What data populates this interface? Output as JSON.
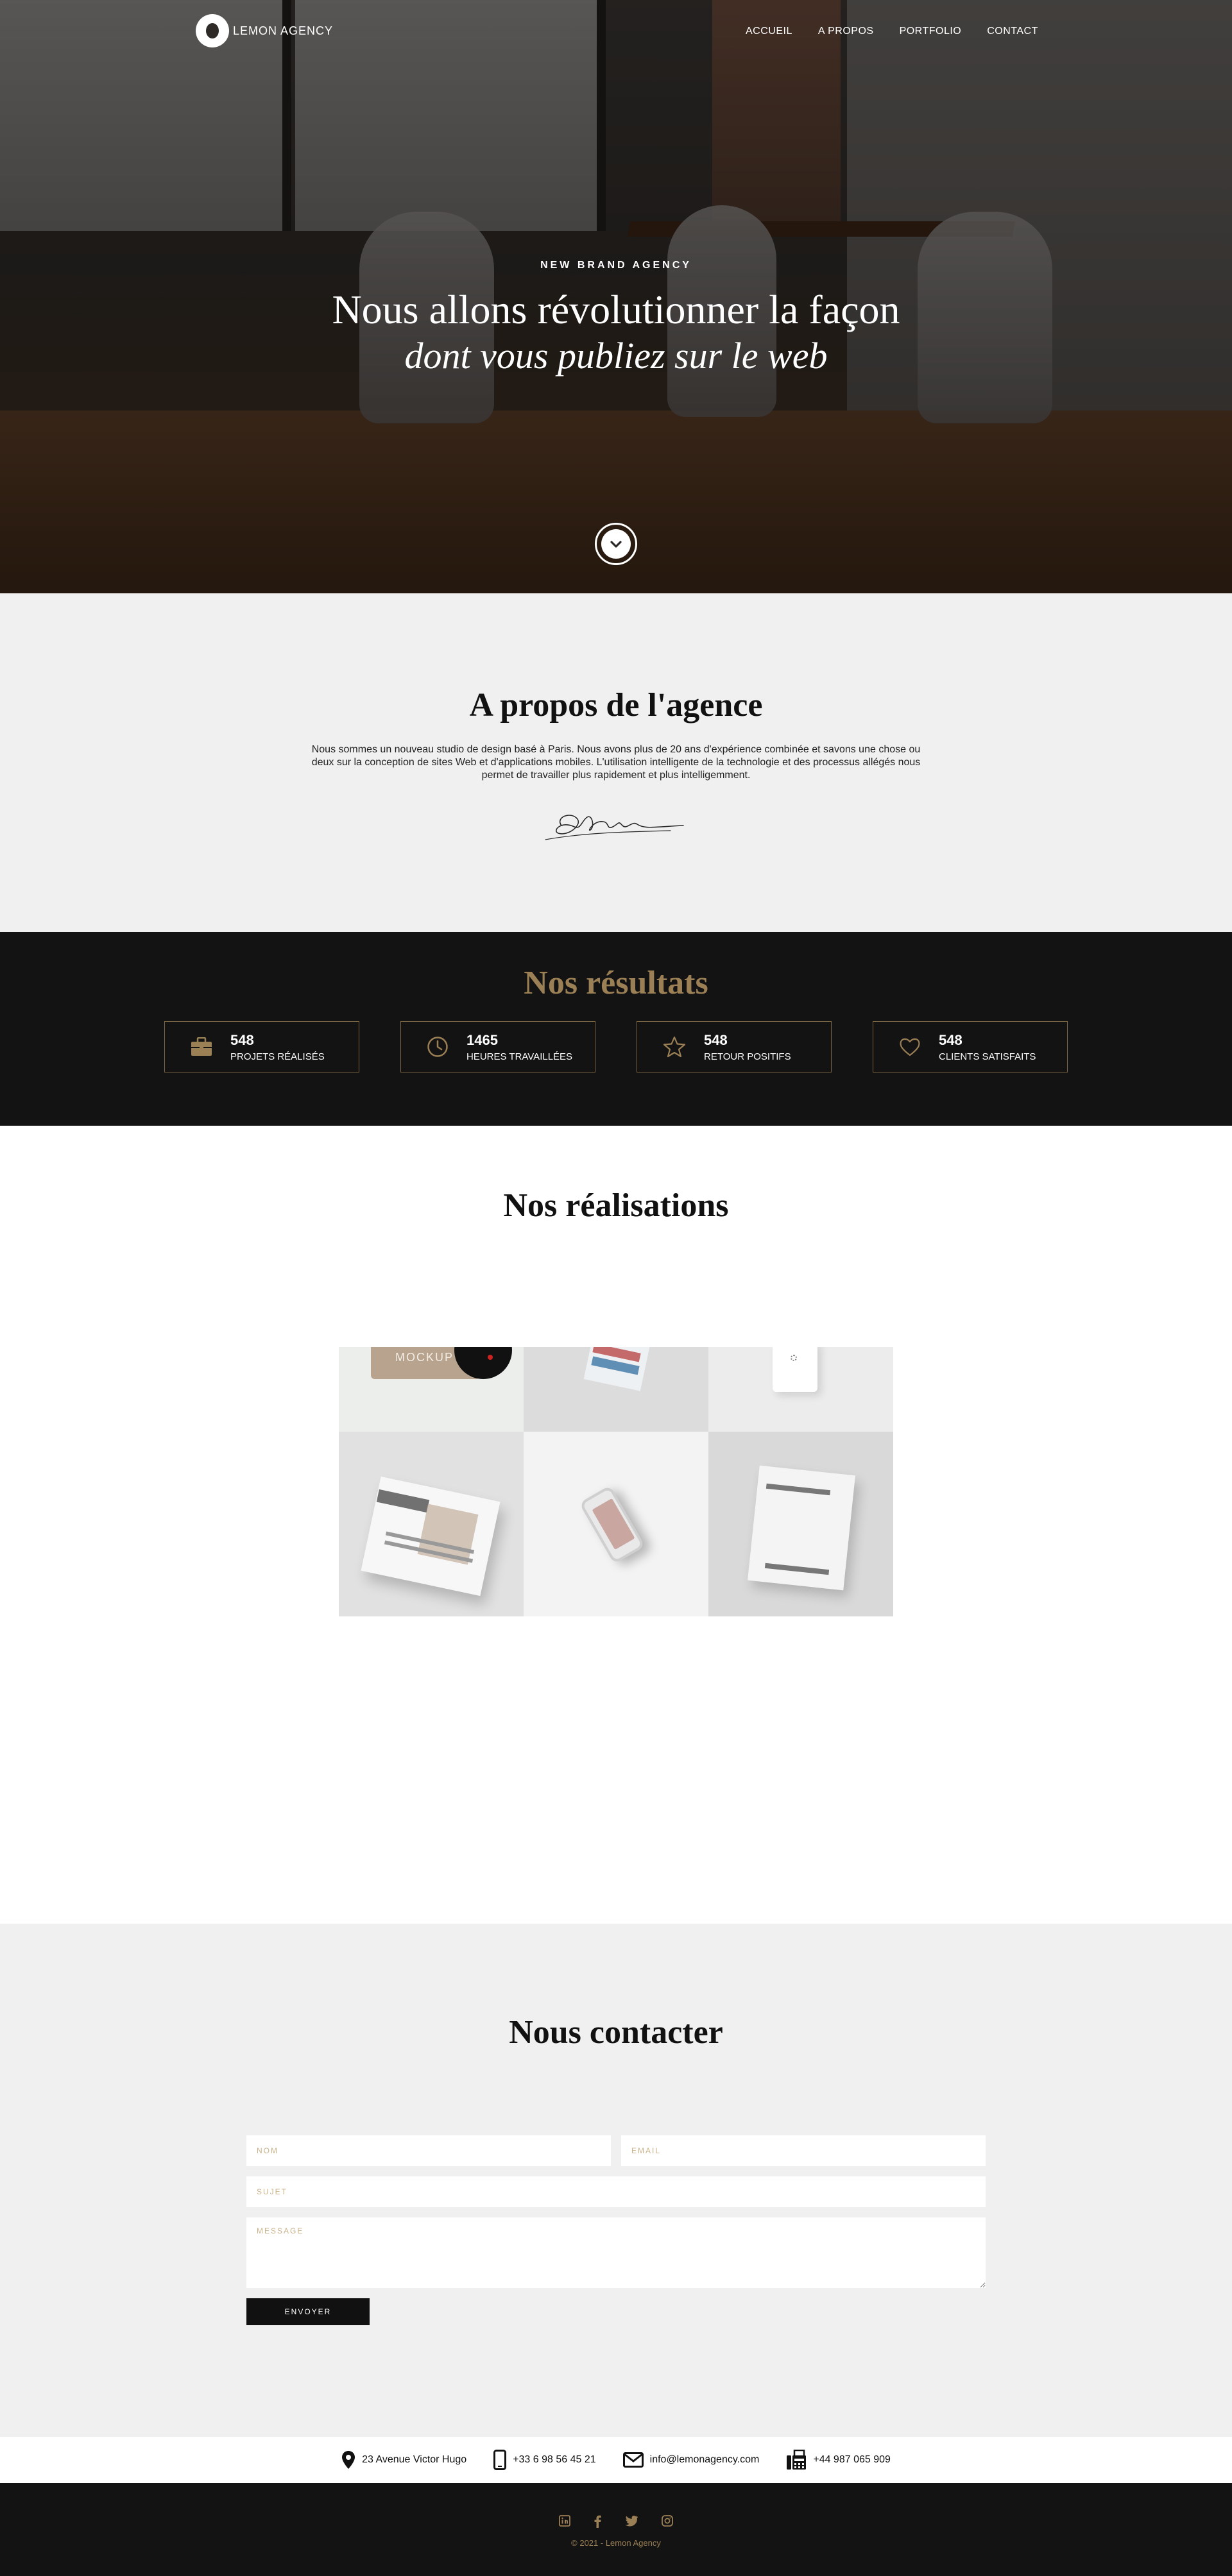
{
  "brand": {
    "name": "LEMON AGENCY"
  },
  "nav": {
    "items": [
      "ACCUEIL",
      "A PROPOS",
      "PORTFOLIO",
      "CONTACT"
    ]
  },
  "hero": {
    "kicker": "NEW BRAND AGENCY",
    "title": "Nous allons révolutionner la façon",
    "subtitle": "dont vous publiez sur le web"
  },
  "about": {
    "title": "A propos de l'agence",
    "text": "Nous sommes un nouveau studio de design basé à Paris. Nous avons plus de 20 ans d'expérience combinée et savons une chose ou deux sur la conception de sites Web et d'applications mobiles. L'utilisation intelligente de la technologie et des processus allégés nous permet de travailler plus rapidement et plus intelligemment."
  },
  "results": {
    "title": "Nos résultats",
    "stats": [
      {
        "icon": "briefcase-icon",
        "value": "548",
        "label": "PROJETS RÉALISÉS"
      },
      {
        "icon": "clock-icon",
        "value": "1465",
        "label": "HEURES TRAVAILLÉES"
      },
      {
        "icon": "star-icon",
        "value": "548",
        "label": "RETOUR POSITIFS"
      },
      {
        "icon": "heart-icon",
        "value": "548",
        "label": "CLIENTS SATISFAITS"
      }
    ]
  },
  "portfolio": {
    "title": "Nos réalisations",
    "tiles": [
      {
        "label": "MOCKUP"
      },
      {
        "label": ""
      },
      {
        "label": ""
      },
      {
        "label": ""
      },
      {
        "label": ""
      },
      {
        "label": ""
      }
    ]
  },
  "contact": {
    "title": "Nous contacter",
    "name_placeholder": "NOM",
    "email_placeholder": "EMAIL",
    "subject_placeholder": "SUJET",
    "message_placeholder": "MESSAGE",
    "send_label": "ENVOYER"
  },
  "info": {
    "address": "23 Avenue Victor Hugo",
    "phone": "+33 6 98 56 45 21",
    "email": "info@lemonagency.com",
    "fax": "+44 987 065 909"
  },
  "footer": {
    "copyright": "© 2021 - Lemon Agency"
  },
  "colors": {
    "accent": "#9b7f55",
    "dark": "#131313",
    "light": "#f0f0f0"
  }
}
